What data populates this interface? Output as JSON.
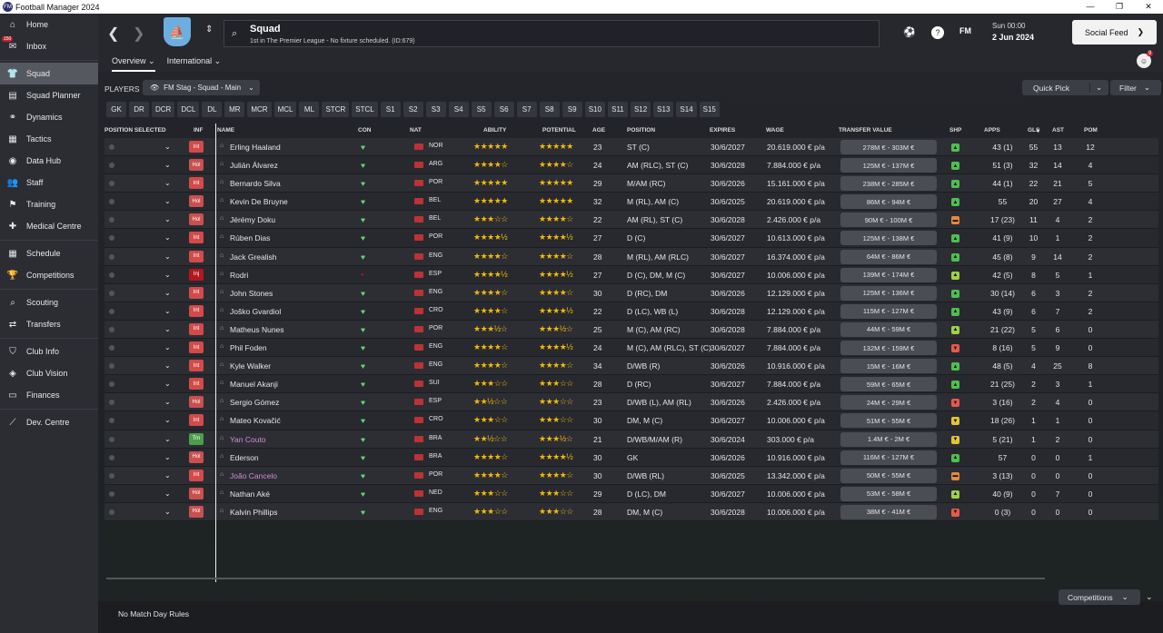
{
  "window": {
    "title": "Football Manager 2024",
    "app_icon": "FM",
    "minimize": "—",
    "maximize": "❐",
    "close": "✕"
  },
  "sidebar": [
    {
      "label": "Home",
      "icon": "home-icon",
      "glyph": "⌂"
    },
    {
      "label": "Inbox",
      "icon": "inbox-icon",
      "glyph": "✉",
      "badge": "150"
    },
    {
      "label": "Squad",
      "icon": "squad-icon",
      "glyph": "👕",
      "active": true
    },
    {
      "label": "Squad Planner",
      "icon": "squad-planner-icon",
      "glyph": "▤"
    },
    {
      "label": "Dynamics",
      "icon": "dynamics-icon",
      "glyph": "⚭"
    },
    {
      "label": "Tactics",
      "icon": "tactics-icon",
      "glyph": "▦"
    },
    {
      "label": "Data Hub",
      "icon": "data-hub-icon",
      "glyph": "◉"
    },
    {
      "label": "Staff",
      "icon": "staff-icon",
      "glyph": "👥"
    },
    {
      "label": "Training",
      "icon": "training-icon",
      "glyph": "⚑"
    },
    {
      "label": "Medical Centre",
      "icon": "medical-icon",
      "glyph": "✚"
    },
    {
      "label": "Schedule",
      "icon": "schedule-icon",
      "glyph": "▦"
    },
    {
      "label": "Competitions",
      "icon": "trophy-icon",
      "glyph": "🏆"
    },
    {
      "label": "Scouting",
      "icon": "scouting-icon",
      "glyph": "⌕"
    },
    {
      "label": "Transfers",
      "icon": "transfers-icon",
      "glyph": "⇄"
    },
    {
      "label": "Club Info",
      "icon": "club-info-icon",
      "glyph": "⛉"
    },
    {
      "label": "Club Vision",
      "icon": "club-vision-icon",
      "glyph": "◈"
    },
    {
      "label": "Finances",
      "icon": "finances-icon",
      "glyph": "▭"
    },
    {
      "label": "Dev. Centre",
      "icon": "dev-centre-icon",
      "glyph": "⟋"
    }
  ],
  "header": {
    "title": "Squad",
    "subtitle": "1st in The Premier League - No fixture scheduled. (ID:679)",
    "date_time": "Sun 00:00",
    "date": "2 Jun 2024",
    "social_feed": "Social Feed",
    "social_badge": "9",
    "fm_label": "FM",
    "tabs": [
      "Overview",
      "International"
    ]
  },
  "toolbar": {
    "players_label": "PLAYERS",
    "view": "FM Stag - Squad - Main",
    "quick_pick": "Quick Pick",
    "filter": "Filter",
    "positions": [
      "GK",
      "DR",
      "DCR",
      "DCL",
      "DL",
      "MR",
      "MCR",
      "MCL",
      "ML",
      "STCR",
      "STCL",
      "S1",
      "S2",
      "S3",
      "S4",
      "S5",
      "S6",
      "S7",
      "S8",
      "S9",
      "S10",
      "S11",
      "S12",
      "S13",
      "S14",
      "S15"
    ]
  },
  "columns": {
    "position_selected": "POSITION SELECTED",
    "inf": "INF",
    "name": "NAME",
    "con": "CON",
    "nat": "NAT",
    "ability": "ABILITY",
    "potential": "POTENTIAL",
    "age": "AGE",
    "position": "POSITION",
    "expires": "EXPIRES",
    "wage": "WAGE",
    "transfer_value": "TRANSFER VALUE",
    "shp": "SHP",
    "apps": "APPS",
    "gls": "GLS",
    "ast": "AST",
    "pom": "POM"
  },
  "colors": {
    "int": "#d24a4a",
    "hol": "#c8504f",
    "inj": "#b3161f",
    "trn": "#4c9e4a",
    "shp_green": "#4ec04e",
    "shp_lime": "#9bd24a",
    "shp_yellow": "#e2c536",
    "shp_orange": "#e58a3b",
    "shp_red": "#e45a4a"
  },
  "players": [
    {
      "inf": "Int",
      "name": "Erling Haaland",
      "con": "♥",
      "nat": "NOR",
      "ability": "★★★★★",
      "potential": "★★★★★",
      "age": "23",
      "position": "ST (C)",
      "expires": "30/6/2027",
      "wage": "20.619.000 € p/a",
      "tv": "278M € - 303M €",
      "shp": "green",
      "apps": "43 (1)",
      "gls": "55",
      "ast": "13",
      "pom": "12"
    },
    {
      "inf": "Hol",
      "name": "Julián Álvarez",
      "con": "♥",
      "nat": "ARG",
      "ability": "★★★★☆",
      "potential": "★★★★☆",
      "age": "24",
      "position": "AM (RLC), ST (C)",
      "expires": "30/6/2028",
      "wage": "7.884.000 € p/a",
      "tv": "125M € - 137M €",
      "shp": "green",
      "apps": "51 (3)",
      "gls": "32",
      "ast": "14",
      "pom": "4"
    },
    {
      "inf": "Int",
      "name": "Bernardo Silva",
      "con": "♥",
      "nat": "POR",
      "ability": "★★★★★",
      "potential": "★★★★★",
      "age": "29",
      "position": "M/AM (RC)",
      "expires": "30/6/2026",
      "wage": "15.161.000 € p/a",
      "tv": "238M € - 285M €",
      "shp": "green",
      "apps": "44 (1)",
      "gls": "22",
      "ast": "21",
      "pom": "5"
    },
    {
      "inf": "Hol",
      "name": "Kevin De Bruyne",
      "con": "♥",
      "nat": "BEL",
      "ability": "★★★★★",
      "potential": "★★★★★",
      "age": "32",
      "position": "M (RL), AM (C)",
      "expires": "30/6/2025",
      "wage": "20.619.000 € p/a",
      "tv": "86M € - 94M €",
      "shp": "green",
      "apps": "55",
      "gls": "20",
      "ast": "27",
      "pom": "4"
    },
    {
      "inf": "Hol",
      "name": "Jérémy Doku",
      "con": "♥",
      "nat": "BEL",
      "ability": "★★★☆☆",
      "potential": "★★★★☆",
      "age": "22",
      "position": "AM (RL), ST (C)",
      "expires": "30/6/2028",
      "wage": "2.426.000 € p/a",
      "tv": "90M € - 100M €",
      "shp": "orange",
      "apps": "17 (23)",
      "gls": "11",
      "ast": "4",
      "pom": "2"
    },
    {
      "inf": "Int",
      "name": "Rúben Dias",
      "con": "♥",
      "nat": "POR",
      "ability": "★★★★½",
      "potential": "★★★★½",
      "age": "27",
      "position": "D (C)",
      "expires": "30/6/2027",
      "wage": "10.613.000 € p/a",
      "tv": "125M € - 138M €",
      "shp": "green",
      "apps": "41 (9)",
      "gls": "10",
      "ast": "1",
      "pom": "2"
    },
    {
      "inf": "Int",
      "name": "Jack Grealish",
      "con": "♥",
      "nat": "ENG",
      "ability": "★★★★☆",
      "potential": "★★★★☆",
      "age": "28",
      "position": "M (RL), AM (RLC)",
      "expires": "30/6/2027",
      "wage": "16.374.000 € p/a",
      "tv": "64M € - 86M €",
      "shp": "green",
      "apps": "45 (8)",
      "gls": "9",
      "ast": "14",
      "pom": "2"
    },
    {
      "inf": "Inj",
      "name": "Rodri",
      "con": "●",
      "nat": "ESP",
      "ability": "★★★★½",
      "potential": "★★★★½",
      "age": "27",
      "position": "D (C), DM, M (C)",
      "expires": "30/6/2027",
      "wage": "10.006.000 € p/a",
      "tv": "139M € - 174M €",
      "shp": "lime",
      "apps": "42 (5)",
      "gls": "8",
      "ast": "5",
      "pom": "1"
    },
    {
      "inf": "Int",
      "name": "John Stones",
      "con": "♥",
      "nat": "ENG",
      "ability": "★★★★☆",
      "potential": "★★★★☆",
      "age": "30",
      "position": "D (RC), DM",
      "expires": "30/6/2026",
      "wage": "12.129.000 € p/a",
      "tv": "125M € - 136M €",
      "shp": "green",
      "apps": "30 (14)",
      "gls": "6",
      "ast": "3",
      "pom": "2"
    },
    {
      "inf": "Int",
      "name": "Joško Gvardiol",
      "con": "♥",
      "nat": "CRO",
      "ability": "★★★★☆",
      "potential": "★★★★½",
      "age": "22",
      "position": "D (LC), WB (L)",
      "expires": "30/6/2028",
      "wage": "12.129.000 € p/a",
      "tv": "115M € - 127M €",
      "shp": "green",
      "apps": "43 (9)",
      "gls": "6",
      "ast": "7",
      "pom": "2"
    },
    {
      "inf": "Int",
      "name": "Matheus Nunes",
      "con": "♥",
      "nat": "POR",
      "ability": "★★★½☆",
      "potential": "★★★½☆",
      "age": "25",
      "position": "M (C), AM (RC)",
      "expires": "30/6/2028",
      "wage": "7.884.000 € p/a",
      "tv": "44M € - 59M €",
      "shp": "lime",
      "apps": "21 (22)",
      "gls": "5",
      "ast": "6",
      "pom": "0"
    },
    {
      "inf": "Int",
      "name": "Phil Foden",
      "con": "♥",
      "nat": "ENG",
      "ability": "★★★★☆",
      "potential": "★★★★½",
      "age": "24",
      "position": "M (C), AM (RLC), ST (C)",
      "expires": "30/6/2027",
      "wage": "7.884.000 € p/a",
      "tv": "132M € - 159M €",
      "shp": "red",
      "apps": "8 (16)",
      "gls": "5",
      "ast": "9",
      "pom": "0"
    },
    {
      "inf": "Int",
      "name": "Kyle Walker",
      "con": "♥",
      "nat": "ENG",
      "ability": "★★★★☆",
      "potential": "★★★★☆",
      "age": "34",
      "position": "D/WB (R)",
      "expires": "30/6/2026",
      "wage": "10.916.000 € p/a",
      "tv": "15M € - 16M €",
      "shp": "green",
      "apps": "48 (5)",
      "gls": "4",
      "ast": "25",
      "pom": "8"
    },
    {
      "inf": "Int",
      "name": "Manuel Akanji",
      "con": "♥",
      "nat": "SUI",
      "ability": "★★★☆☆",
      "potential": "★★★☆☆",
      "age": "28",
      "position": "D (RC)",
      "expires": "30/6/2027",
      "wage": "7.884.000 € p/a",
      "tv": "59M € - 65M €",
      "shp": "green",
      "apps": "21 (25)",
      "gls": "2",
      "ast": "3",
      "pom": "1"
    },
    {
      "inf": "Hol",
      "name": "Sergio Gómez",
      "con": "♥",
      "nat": "ESP",
      "ability": "★★½☆☆",
      "potential": "★★★☆☆",
      "age": "23",
      "position": "D/WB (L), AM (RL)",
      "expires": "30/6/2026",
      "wage": "2.426.000 € p/a",
      "tv": "24M € - 29M €",
      "shp": "red",
      "apps": "3 (16)",
      "gls": "2",
      "ast": "4",
      "pom": "0"
    },
    {
      "inf": "Int",
      "name": "Mateo Kovačić",
      "con": "♥",
      "nat": "CRO",
      "ability": "★★★☆☆",
      "potential": "★★★☆☆",
      "age": "30",
      "position": "DM, M (C)",
      "expires": "30/6/2027",
      "wage": "10.006.000 € p/a",
      "tv": "51M € - 55M €",
      "shp": "yellow",
      "apps": "18 (26)",
      "gls": "1",
      "ast": "1",
      "pom": "0"
    },
    {
      "inf": "Trn",
      "name": "Yan Couto",
      "con": "♥",
      "nat": "BRA",
      "ability": "★★½☆☆",
      "potential": "★★★½☆",
      "age": "21",
      "position": "D/WB/M/AM (R)",
      "expires": "30/6/2024",
      "wage": "303.000 € p/a",
      "tv": "1.4M € - 2M €",
      "shp": "yellow",
      "apps": "5 (21)",
      "gls": "1",
      "ast": "2",
      "pom": "0",
      "highlight": true
    },
    {
      "inf": "Hol",
      "name": "Ederson",
      "con": "♥",
      "nat": "BRA",
      "ability": "★★★★☆",
      "potential": "★★★★½",
      "age": "30",
      "position": "GK",
      "expires": "30/6/2026",
      "wage": "10.916.000 € p/a",
      "tv": "116M € - 127M €",
      "shp": "green",
      "apps": "57",
      "gls": "0",
      "ast": "0",
      "pom": "1"
    },
    {
      "inf": "Int",
      "name": "João Cancelo",
      "con": "♥",
      "nat": "POR",
      "ability": "★★★★☆",
      "potential": "★★★★☆",
      "age": "30",
      "position": "D/WB (RL)",
      "expires": "30/6/2025",
      "wage": "13.342.000 € p/a",
      "tv": "50M € - 55M €",
      "shp": "orange",
      "apps": "3 (13)",
      "gls": "0",
      "ast": "0",
      "pom": "0",
      "highlight": true
    },
    {
      "inf": "Hol",
      "name": "Nathan Aké",
      "con": "♥",
      "nat": "NED",
      "ability": "★★★☆☆",
      "potential": "★★★☆☆",
      "age": "29",
      "position": "D (LC), DM",
      "expires": "30/6/2027",
      "wage": "10.006.000 € p/a",
      "tv": "53M € - 58M €",
      "shp": "lime",
      "apps": "40 (9)",
      "gls": "0",
      "ast": "7",
      "pom": "0"
    },
    {
      "inf": "Hol",
      "name": "Kalvin Phillips",
      "con": "♥",
      "nat": "ENG",
      "ability": "★★★☆☆",
      "potential": "★★★☆☆",
      "age": "28",
      "position": "DM, M (C)",
      "expires": "30/6/2028",
      "wage": "10.006.000 € p/a",
      "tv": "38M € - 41M €",
      "shp": "red",
      "apps": "0 (3)",
      "gls": "0",
      "ast": "0",
      "pom": "0"
    }
  ],
  "footer": {
    "rules": "No Match Day Rules",
    "competitions": "Competitions"
  }
}
